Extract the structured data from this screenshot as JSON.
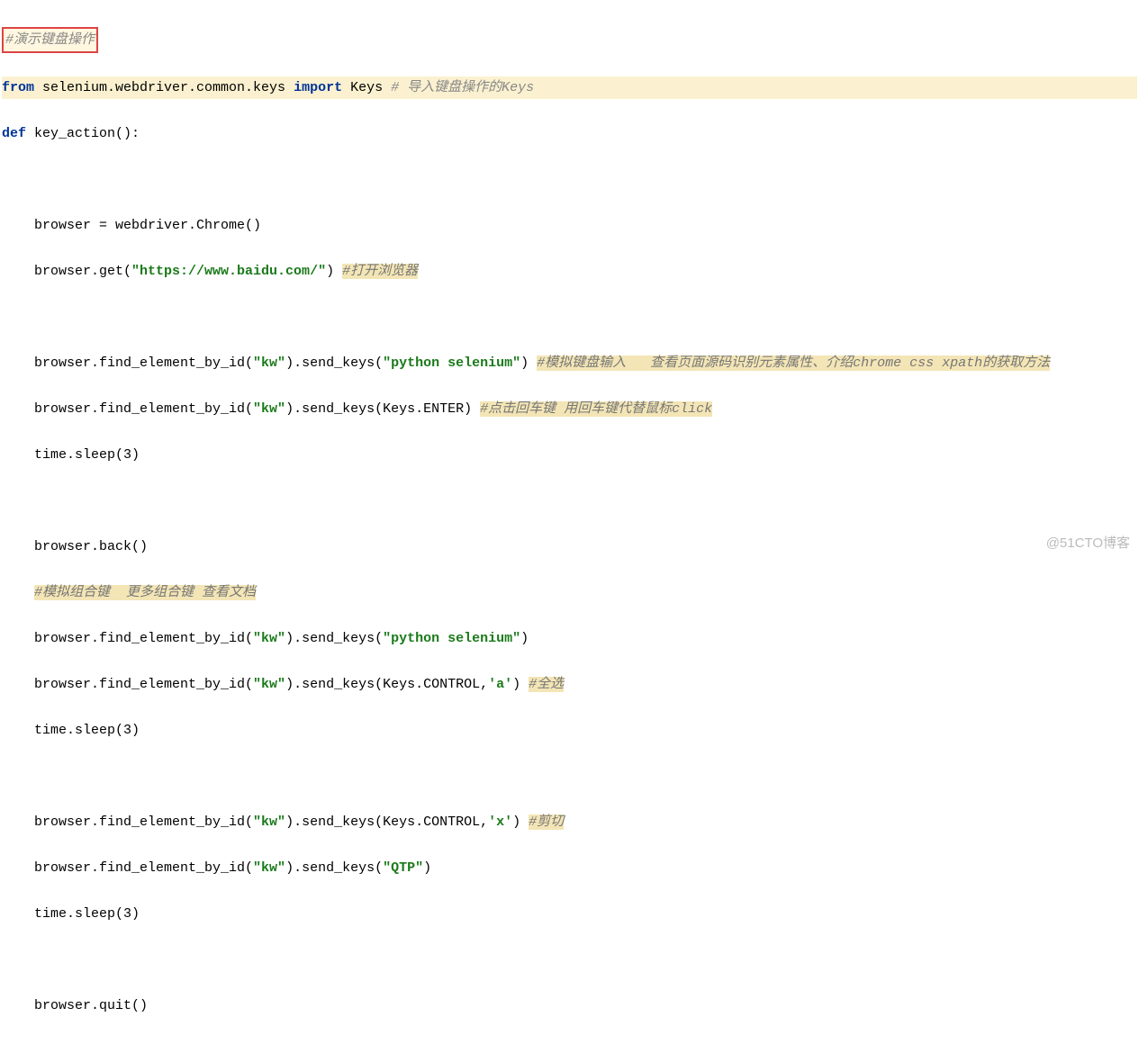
{
  "title_comment": "#演示键盘操作",
  "import_line": {
    "from_kw": "from",
    "module": " selenium.webdriver.common.keys ",
    "import_kw": "import",
    "name": " Keys ",
    "comment": "# 导入键盘操作的Keys"
  },
  "def_line": {
    "def_kw": "def",
    "name": " key_action():"
  },
  "l1": "    browser = webdriver.Chrome()",
  "l2a": "    browser.get(",
  "l2str": "\"https://www.baidu.com/\"",
  "l2b": ") ",
  "l2c": "#打开浏览器",
  "l3a": "    browser.find_element_by_id(",
  "l3str1": "\"kw\"",
  "l3b": ").send_keys(",
  "l3str2": "\"python selenium\"",
  "l3c": ") ",
  "l3d": "#模拟键盘输入   查看页面源码识别元素属性、介绍chrome css xpath的获取方法",
  "l4a": "    browser.find_element_by_id(",
  "l4str1": "\"kw\"",
  "l4b": ").send_keys(Keys.ENTER) ",
  "l4c": "#点击回车键 用回车键代替鼠标click",
  "l5": "    time.sleep(3)",
  "l6": "    browser.back()",
  "l7": "    #模拟组合键  更多组合键 查看文档",
  "l8a": "    browser.find_element_by_id(",
  "l8str1": "\"kw\"",
  "l8b": ").send_keys(",
  "l8str2": "\"python selenium\"",
  "l8c": ")",
  "l9a": "    browser.find_element_by_id(",
  "l9str1": "\"kw\"",
  "l9b": ").send_keys(Keys.CONTROL,",
  "l9str2": "'a'",
  "l9c": ") ",
  "l9d": "#全选",
  "l10": "    time.sleep(3)",
  "l11a": "    browser.find_element_by_id(",
  "l11str1": "\"kw\"",
  "l11b": ").send_keys(Keys.CONTROL,",
  "l11str2": "'x'",
  "l11c": ") ",
  "l11d": "#剪切",
  "l12a": "    browser.find_element_by_id(",
  "l12str1": "\"kw\"",
  "l12b": ").send_keys(",
  "l12str2": "\"QTP\"",
  "l12c": ")",
  "l13": "    time.sleep(3)",
  "l14": "    browser.quit()",
  "watermark": "@51CTO博客"
}
